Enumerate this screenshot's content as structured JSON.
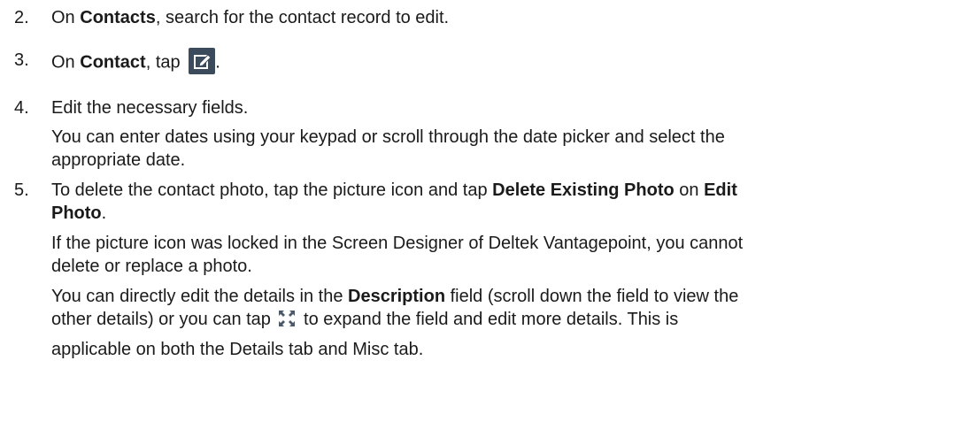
{
  "steps": [
    {
      "number": "2.",
      "parts": {
        "a": "On ",
        "b": "Contacts",
        "c": ", search for the contact record to edit."
      }
    },
    {
      "number": "3.",
      "parts": {
        "a": "On ",
        "b": "Contact",
        "c": ", tap ",
        "d": "."
      },
      "icon": "edit-icon"
    },
    {
      "number": "4.",
      "main": "Edit the necessary fields.",
      "note1": "You can enter dates using your keypad or scroll through the date picker and select the",
      "note2": "appropriate date."
    },
    {
      "number": "5.",
      "l1": {
        "a": "To delete the contact photo, tap the picture icon and tap ",
        "b": "Delete Existing Photo",
        "c": " on ",
        "d": "Edit"
      },
      "l2": {
        "b": "Photo",
        "c": "."
      },
      "n1": "If the picture icon was locked in the Screen Designer of Deltek Vantagepoint, you cannot",
      "n2": "delete or replace a photo.",
      "d1": {
        "a": "You can directly edit the details in the ",
        "b": "Description",
        "c": " field (scroll down the field to view the"
      },
      "d2": {
        "a": "other details) or you can tap ",
        "c": " to expand the field and edit more details. This is"
      },
      "d3": "applicable on both the Details tab and Misc tab.",
      "icon": "expand-icon"
    }
  ],
  "colors": {
    "text": "#1a1a1a",
    "edit_icon_bg": "#3c4b5c",
    "expand_icon": "#4a5a6a"
  }
}
